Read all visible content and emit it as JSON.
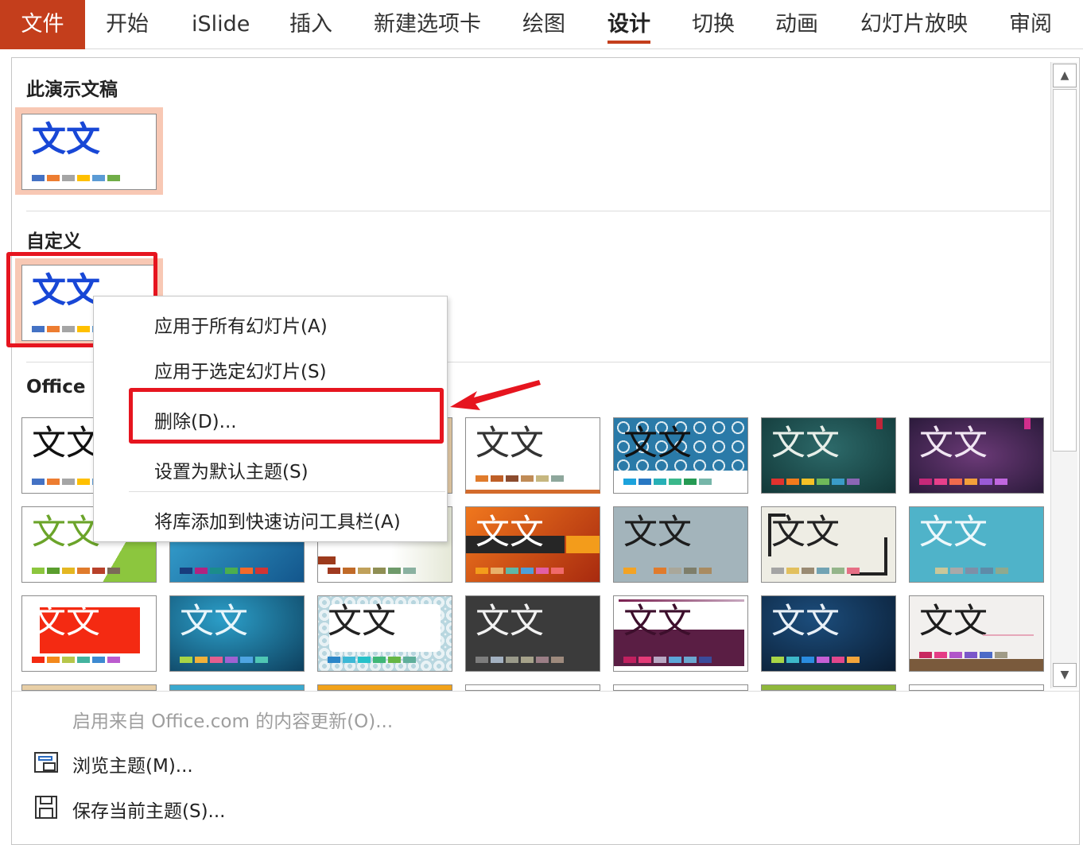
{
  "ribbon": {
    "tabs": [
      "文件",
      "开始",
      "iSlide",
      "插入",
      "新建选项卡",
      "绘图",
      "设计",
      "切换",
      "动画",
      "幻灯片放映",
      "审阅"
    ],
    "active_tab": "设计"
  },
  "gallery": {
    "section_this": "此演示文稿",
    "section_custom": "自定义",
    "section_office": "Office",
    "thumb_text": "文文"
  },
  "context_menu": {
    "apply_all": "应用于所有幻灯片(A)",
    "apply_selected": "应用于选定幻灯片(S)",
    "delete": "删除(D)...",
    "set_default": "设置为默认主题(S)",
    "add_to_qat": "将库添加到快速访问工具栏(A)"
  },
  "commands": {
    "enable_updates": "启用来自 Office.com 的内容更新(O)...",
    "browse_themes": "浏览主题(M)...",
    "save_theme": "保存当前主题(S)..."
  },
  "colors": {
    "accent": "#c43e1c",
    "highlight": "#e6151f",
    "selection": "#f8c8b4"
  }
}
